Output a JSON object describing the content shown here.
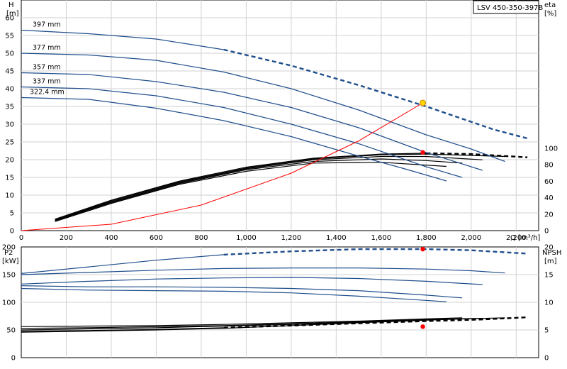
{
  "chart_data": [
    {
      "type": "line",
      "title": "LSV 450-350-397B",
      "xlabel": "Q [m³/h]",
      "ylabel_left": [
        "H",
        "[m]"
      ],
      "ylabel_right": [
        "eta",
        "[%]"
      ],
      "xlim": [
        0,
        2300
      ],
      "ylim": [
        0,
        65
      ],
      "ylim_right": [
        0,
        280
      ],
      "xticks": [
        0,
        200,
        400,
        600,
        800,
        1000,
        1200,
        1400,
        1600,
        1800,
        2000,
        2200
      ],
      "xtick_labels": [
        "0",
        "200",
        "400",
        "600",
        "800",
        "1,000",
        "1,200",
        "1,400",
        "1,600",
        "1,800",
        "2,000",
        "2,200"
      ],
      "yticks": [
        0,
        5,
        10,
        15,
        20,
        25,
        30,
        35,
        40,
        45,
        50,
        55,
        60
      ],
      "yticks_right": [
        0,
        20,
        40,
        60,
        80,
        100
      ],
      "grid": true,
      "head_curves": [
        {
          "name": "397 mm",
          "x": [
            0,
            300,
            600,
            900,
            1200,
            1500,
            1800,
            2100,
            2250
          ],
          "y": [
            56.5,
            55.5,
            54,
            51,
            46.5,
            41,
            35,
            28.5,
            26
          ],
          "dashed_from": 900
        },
        {
          "name": "377 mm",
          "x": [
            0,
            300,
            600,
            900,
            1200,
            1500,
            1800,
            2000,
            2150
          ],
          "y": [
            50,
            49.5,
            48,
            44.7,
            40,
            34,
            27,
            23,
            19.5
          ]
        },
        {
          "name": "357 mm",
          "x": [
            0,
            300,
            600,
            900,
            1200,
            1500,
            1800,
            2050
          ],
          "y": [
            44.5,
            44,
            42,
            39,
            34.7,
            29,
            22,
            17
          ]
        },
        {
          "name": "337 mm",
          "x": [
            0,
            300,
            600,
            900,
            1200,
            1500,
            1800,
            1960
          ],
          "y": [
            40.5,
            40,
            38,
            34.7,
            30,
            24.5,
            18,
            15
          ]
        },
        {
          "name": "322.4 mm",
          "x": [
            0,
            300,
            600,
            900,
            1200,
            1500,
            1700,
            1890
          ],
          "y": [
            37.5,
            37,
            34.5,
            31,
            26.5,
            21,
            17.5,
            14
          ]
        }
      ],
      "efficiency_curves": [
        {
          "x": [
            150,
            400,
            700,
            1000,
            1300,
            1600,
            1800,
            2000,
            2250
          ],
          "y": [
            14,
            37,
            60,
            77,
            88,
            93,
            94,
            93,
            89
          ],
          "dashed_from": 1800
        },
        {
          "x": [
            150,
            400,
            700,
            1000,
            1300,
            1600,
            1800,
            2150
          ],
          "y": [
            13,
            36,
            59,
            76,
            87,
            92,
            93,
            90
          ]
        },
        {
          "x": [
            150,
            400,
            700,
            1000,
            1300,
            1600,
            1800,
            2050
          ],
          "y": [
            12.5,
            35,
            58,
            75,
            86,
            90,
            90,
            86
          ]
        },
        {
          "x": [
            150,
            400,
            700,
            1000,
            1300,
            1600,
            1800,
            1960
          ],
          "y": [
            12,
            34,
            57,
            74,
            84,
            87,
            85,
            82
          ]
        },
        {
          "x": [
            150,
            400,
            700,
            1000,
            1300,
            1600,
            1890
          ],
          "y": [
            11,
            33,
            56,
            72,
            82,
            83,
            78
          ]
        }
      ],
      "system_curve": {
        "x": [
          0,
          400,
          800,
          1200,
          1500,
          1785
        ],
        "y": [
          0,
          1.8,
          7.2,
          16.2,
          25.3,
          36
        ]
      },
      "duty_point": {
        "x": 1785,
        "y": 36
      },
      "eta_point": {
        "x": 1785,
        "y": 95
      }
    },
    {
      "type": "line",
      "ylabel_left": [
        "P2",
        "[kW]"
      ],
      "ylabel_right": [
        "NPSH",
        "[m]"
      ],
      "xlim": [
        0,
        2300
      ],
      "ylim": [
        0,
        200
      ],
      "ylim_right": [
        0,
        20
      ],
      "yticks": [
        0,
        50,
        100,
        150,
        200
      ],
      "yticks_right": [
        0,
        5,
        10,
        15,
        20
      ],
      "grid": true,
      "power_curves": [
        {
          "x": [
            0,
            300,
            600,
            900,
            1200,
            1500,
            1800,
            2000,
            2250
          ],
          "y": [
            152,
            164,
            176,
            186,
            192,
            196,
            196,
            194,
            188
          ],
          "dashed_from": 900
        },
        {
          "x": [
            0,
            300,
            600,
            900,
            1200,
            1500,
            1800,
            2000,
            2150
          ],
          "y": [
            150,
            154,
            158,
            161,
            162,
            162,
            160,
            157,
            153
          ]
        },
        {
          "x": [
            0,
            300,
            600,
            900,
            1200,
            1500,
            1800,
            2050
          ],
          "y": [
            133,
            138,
            142,
            144,
            145,
            143,
            138,
            132
          ]
        },
        {
          "x": [
            0,
            300,
            600,
            900,
            1200,
            1500,
            1800,
            1960
          ],
          "y": [
            130,
            128,
            128,
            127,
            125,
            121,
            113,
            108
          ]
        },
        {
          "x": [
            0,
            300,
            600,
            900,
            1200,
            1500,
            1700,
            1890
          ],
          "y": [
            125,
            122,
            121,
            120,
            117,
            111,
            106,
            101
          ]
        }
      ],
      "npsh_curves": [
        {
          "x": [
            0,
            300,
            600,
            900,
            1200,
            1500,
            1800,
            2050,
            2250
          ],
          "y": [
            4.8,
            4.9,
            5.1,
            5.4,
            5.8,
            6.2,
            6.6,
            6.9,
            7.3
          ],
          "dashed_from": 900
        },
        {
          "x": [
            0,
            300,
            600,
            900,
            1200,
            1500,
            1800,
            2150
          ],
          "y": [
            5.0,
            5.2,
            5.4,
            5.7,
            6.0,
            6.4,
            6.8,
            7.2
          ]
        },
        {
          "x": [
            0,
            300,
            600,
            900,
            1200,
            1500,
            1800,
            2050
          ],
          "y": [
            5.3,
            5.4,
            5.6,
            5.8,
            6.1,
            6.5,
            6.9,
            7.1
          ]
        },
        {
          "x": [
            0,
            300,
            600,
            900,
            1200,
            1500,
            1800,
            1960
          ],
          "y": [
            5.6,
            5.7,
            5.8,
            6.0,
            6.3,
            6.6,
            7.0,
            7.2
          ]
        },
        {
          "x": [
            0,
            300,
            600,
            900,
            1200,
            1500,
            1890
          ],
          "y": [
            4.6,
            4.8,
            5.0,
            5.3,
            5.8,
            6.3,
            6.9
          ]
        }
      ],
      "power_point": {
        "x": 1785,
        "y": 196
      },
      "npsh_point": {
        "x": 1785,
        "y": 5.6
      }
    }
  ],
  "colors": {
    "head": "#1f4e8c",
    "efficiency": "#000000",
    "system": "#ff0000",
    "duty": "#ffd700",
    "marker": "#ff0000",
    "grid": "#d2d2d2"
  }
}
